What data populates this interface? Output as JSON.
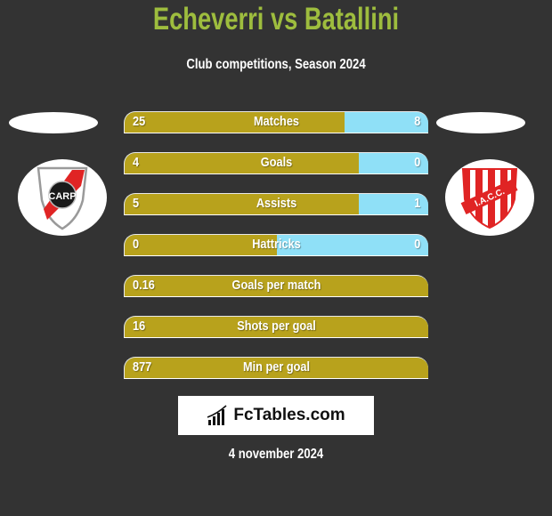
{
  "header": {
    "title": "Echeverri vs Batallini",
    "subtitle": "Club competitions, Season 2024"
  },
  "colors": {
    "title": "#9ebd3e",
    "left_bar": "#b8a21c",
    "right_bar": "#8fe0f7",
    "background": "#333333"
  },
  "teams": {
    "left": {
      "logo": "river-plate-crest",
      "crest_text": "CARP"
    },
    "right": {
      "logo": "instituto-crest",
      "crest_text": "I.A.C.C."
    }
  },
  "stats": [
    {
      "label": "Matches",
      "left": "25",
      "right": "8",
      "left_fill": 0.725
    },
    {
      "label": "Goals",
      "left": "4",
      "right": "0",
      "left_fill": 0.77
    },
    {
      "label": "Assists",
      "left": "5",
      "right": "1",
      "left_fill": 0.77
    },
    {
      "label": "Hattricks",
      "left": "0",
      "right": "0",
      "left_fill": 0.5
    },
    {
      "label": "Goals per match",
      "left": "0.16",
      "right": "",
      "left_fill": 1.0
    },
    {
      "label": "Shots per goal",
      "left": "16",
      "right": "",
      "left_fill": 1.0
    },
    {
      "label": "Min per goal",
      "left": "877",
      "right": "",
      "left_fill": 1.0
    }
  ],
  "footer": {
    "brand": "FcTables.com",
    "date": "4 november 2024"
  }
}
